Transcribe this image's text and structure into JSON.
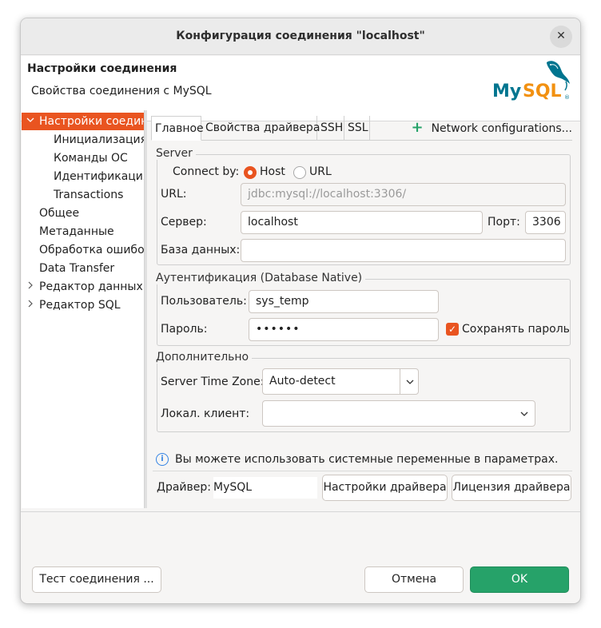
{
  "window": {
    "title": "Конфигурация соединения \"localhost\"",
    "close_glyph": "✕"
  },
  "header": {
    "title": "Настройки соединения",
    "subtitle": "Свойства соединения с MySQL",
    "logo_text": "MySQL"
  },
  "nav": {
    "items": [
      {
        "label": "Настройки соединения",
        "selected": true,
        "expander": "expanded"
      },
      {
        "label": "Инициализация"
      },
      {
        "label": "Команды ОС"
      },
      {
        "label": "Идентификация"
      },
      {
        "label": "Transactions"
      },
      {
        "label": "Общее"
      },
      {
        "label": "Метаданные"
      },
      {
        "label": "Обработка ошибок"
      },
      {
        "label": "Data Transfer"
      },
      {
        "label": "Редактор данных",
        "expander": "collapsed"
      },
      {
        "label": "Редактор SQL",
        "expander": "collapsed"
      }
    ]
  },
  "tabs": [
    {
      "label": "Главное",
      "active": true
    },
    {
      "label": "Свойства драйвера"
    },
    {
      "label": "SSH"
    },
    {
      "label": "SSL"
    }
  ],
  "network_configurations": {
    "icon": "+",
    "label": "Network configurations..."
  },
  "server": {
    "group_label": "Server",
    "connect_by_label": "Connect by:",
    "option_host": "Host",
    "option_url": "URL",
    "selected": "Host",
    "url_label": "URL:",
    "url_value": "jdbc:mysql://localhost:3306/",
    "server_label": "Сервер:",
    "server_value": "localhost",
    "port_label": "Порт:",
    "port_value": "3306",
    "database_label": "База данных:",
    "database_value": ""
  },
  "auth": {
    "group_label": "Аутентификация (Database Native)",
    "user_label": "Пользователь:",
    "user_value": "sys_temp",
    "password_label": "Пароль:",
    "password_value": "••••••",
    "save_password_label": "Сохранять пароль",
    "save_password_checked": true
  },
  "advanced": {
    "group_label": "Дополнительно",
    "timezone_label": "Server Time Zone:",
    "timezone_value": "Auto-detect",
    "local_client_label": "Локал. клиент:",
    "local_client_value": ""
  },
  "info": {
    "icon": "i",
    "text": "Вы можете использовать системные переменные в параметрах."
  },
  "driver": {
    "label": "Драйвер:",
    "value": "MySQL",
    "settings_button": "Настройки драйвера",
    "license_button": "Лицензия драйвера"
  },
  "footer": {
    "test_button": "Тест соединения ...",
    "cancel_button": "Отмена",
    "ok_button": "OK"
  },
  "colors": {
    "accent": "#e95420",
    "ok_green": "#26a269",
    "info_blue": "#3584e4",
    "mysql_blue": "#00758f",
    "mysql_orange": "#f29111"
  }
}
